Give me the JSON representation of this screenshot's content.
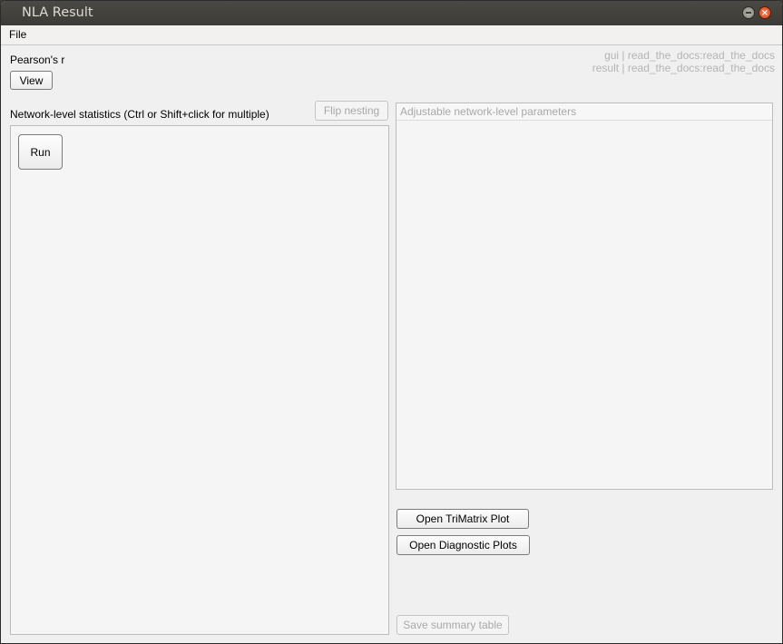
{
  "window": {
    "title": "NLA Result"
  },
  "menubar": {
    "file_label": "File"
  },
  "header": {
    "method_label": "Pearson's r",
    "view_button": "View",
    "version_gui": "gui | read_the_docs:read_the_docs",
    "version_result": "result | read_the_docs:read_the_docs"
  },
  "stats_panel": {
    "title": "Network-level statistics (Ctrl or Shift+click for multiple)",
    "flip_nesting_button": "Flip nesting",
    "run_button": "Run"
  },
  "params_panel": {
    "title": "Adjustable network-level parameters"
  },
  "actions": {
    "open_trimatrix": "Open TriMatrix Plot",
    "open_diagnostic": "Open Diagnostic Plots",
    "save_summary": "Save summary table"
  }
}
